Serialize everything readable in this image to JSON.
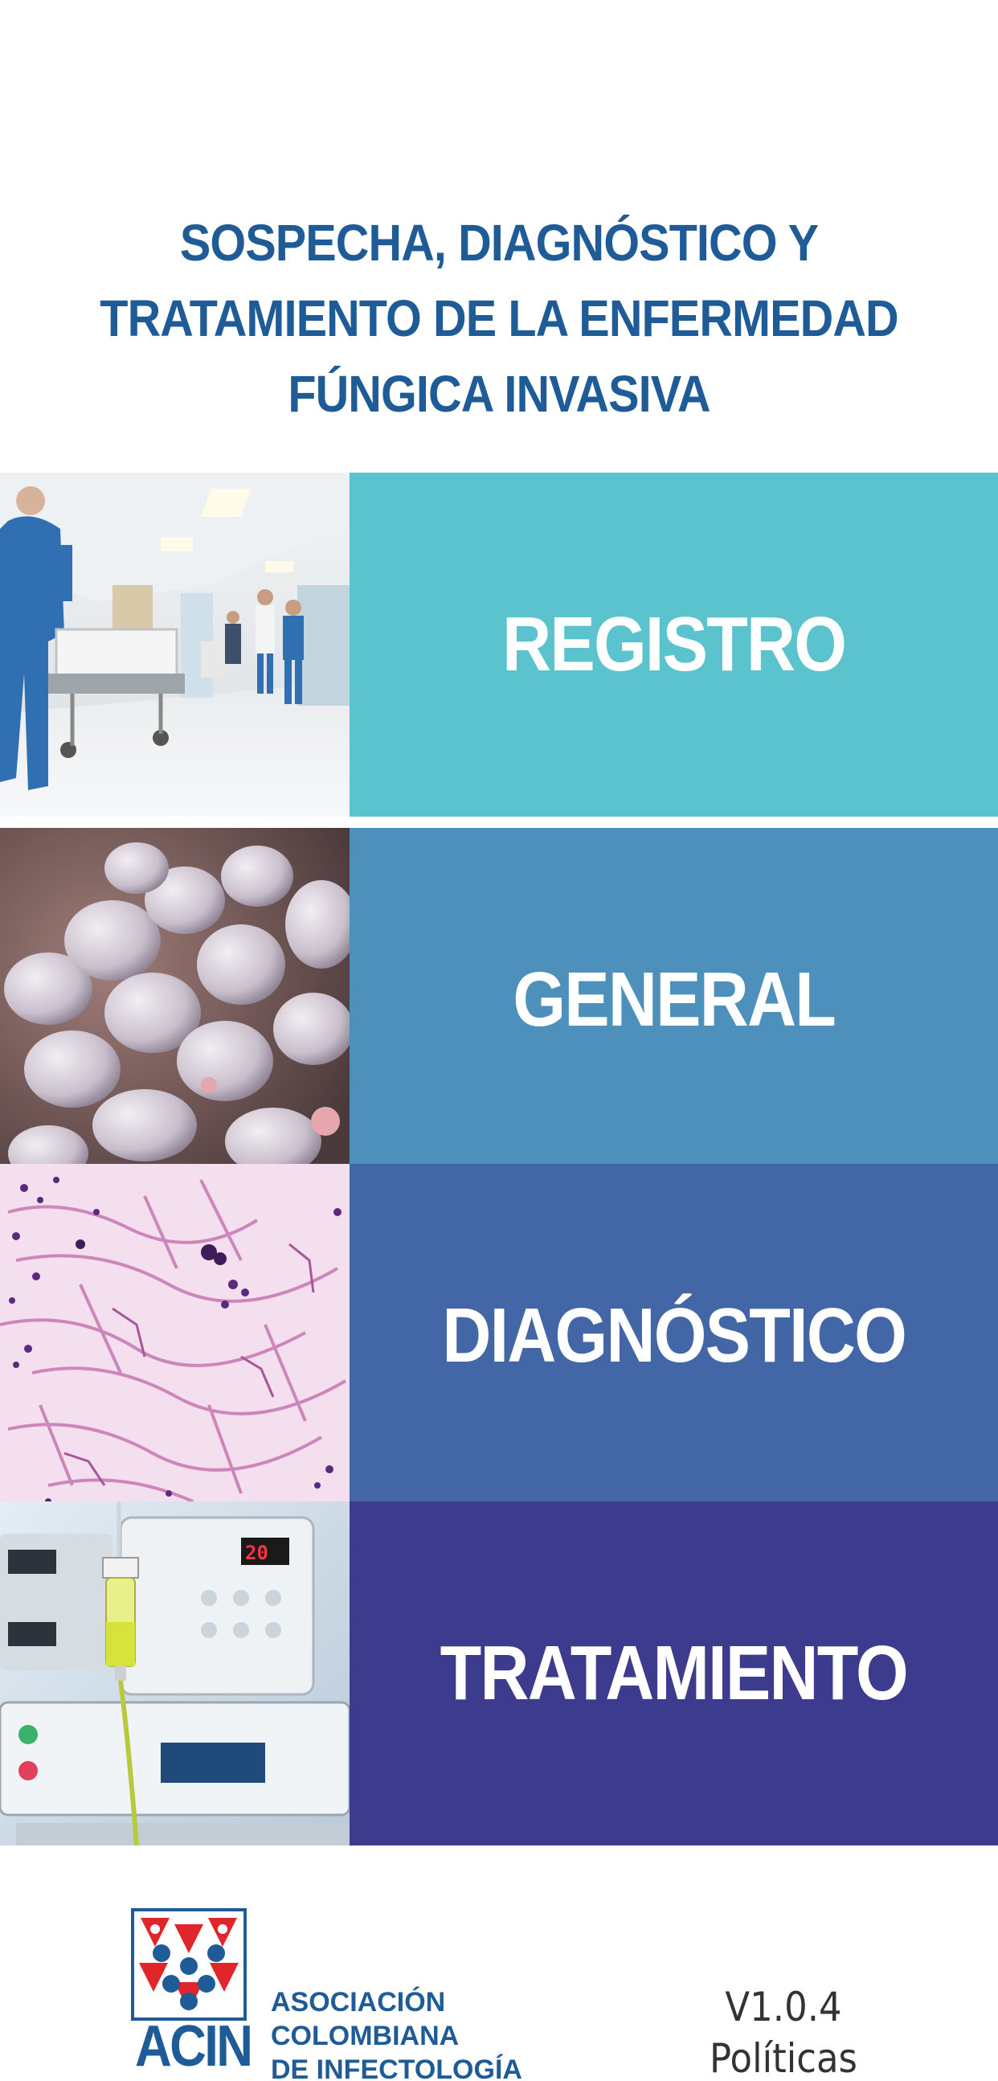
{
  "title": {
    "lines": [
      "SOSPECHA, DIAGNÓSTICO Y",
      "TRATAMIENTO DE LA ENFERMEDAD",
      "FÚNGICA INVASIVA"
    ]
  },
  "menu": [
    {
      "label": "REGISTRO",
      "color": "#5bc3cd",
      "image": "hospital-corridor-photo"
    },
    {
      "label": "GENERAL",
      "color": "#4c90bb",
      "image": "yeast-cells-photo"
    },
    {
      "label": "DIAGNÓSTICO",
      "color": "#4366a6",
      "image": "histology-hyphae-photo"
    },
    {
      "label": "TRATAMIENTO",
      "color": "#3d3b8e",
      "image": "iv-infusion-pump-photo"
    }
  ],
  "footer": {
    "logo_text": "ACIN",
    "org_lines": [
      "ASOCIACIÓN",
      "COLOMBIANA",
      "DE INFECTOLOGÍA"
    ],
    "version": "V1.0.4",
    "policies_link": "Políticas"
  },
  "colors": {
    "brand_blue": "#1f5c97",
    "logo_red": "#e0262b"
  }
}
